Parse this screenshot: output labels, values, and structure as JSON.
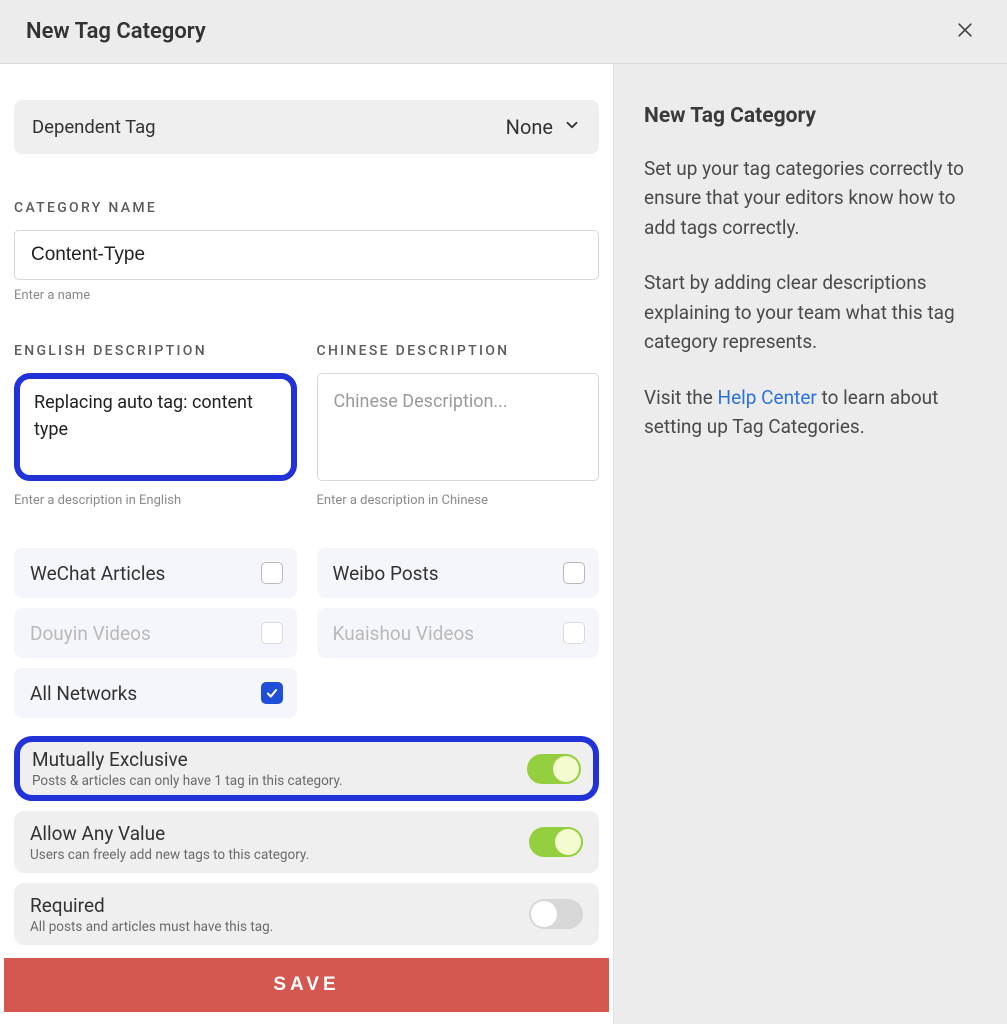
{
  "header": {
    "title": "New Tag Category"
  },
  "dependent": {
    "label": "Dependent Tag",
    "value": "None"
  },
  "categoryName": {
    "label": "CATEGORY NAME",
    "value": "Content-Type",
    "hint": "Enter a name"
  },
  "desc": {
    "en": {
      "label": "ENGLISH DESCRIPTION",
      "value": "Replacing auto tag: content type",
      "hint": "Enter a description in English"
    },
    "zh": {
      "label": "CHINESE DESCRIPTION",
      "placeholder": "Chinese Description...",
      "hint": "Enter a description in Chinese"
    }
  },
  "networks": {
    "wechat": {
      "label": "WeChat Articles",
      "checked": false,
      "disabled": false
    },
    "weibo": {
      "label": "Weibo Posts",
      "checked": false,
      "disabled": false
    },
    "douyin": {
      "label": "Douyin Videos",
      "checked": false,
      "disabled": true
    },
    "kuaishou": {
      "label": "Kuaishou Videos",
      "checked": false,
      "disabled": true
    },
    "all": {
      "label": "All Networks",
      "checked": true,
      "disabled": false
    }
  },
  "options": {
    "mutex": {
      "title": "Mutually Exclusive",
      "sub": "Posts & articles can only have 1 tag in this category.",
      "on": true
    },
    "anyval": {
      "title": "Allow Any Value",
      "sub": "Users can freely add new tags to this category.",
      "on": true
    },
    "required": {
      "title": "Required",
      "sub": "All posts and articles must have this tag.",
      "on": false
    }
  },
  "save": "SAVE",
  "help": {
    "title": "New Tag Category",
    "p1": "Set up your tag categories correctly to ensure that your editors know how to add tags correctly.",
    "p2": "Start by adding clear descriptions explaining to your team what this tag category represents.",
    "p3a": "Visit the ",
    "link": "Help Center",
    "p3b": " to learn about setting up Tag Categories."
  }
}
